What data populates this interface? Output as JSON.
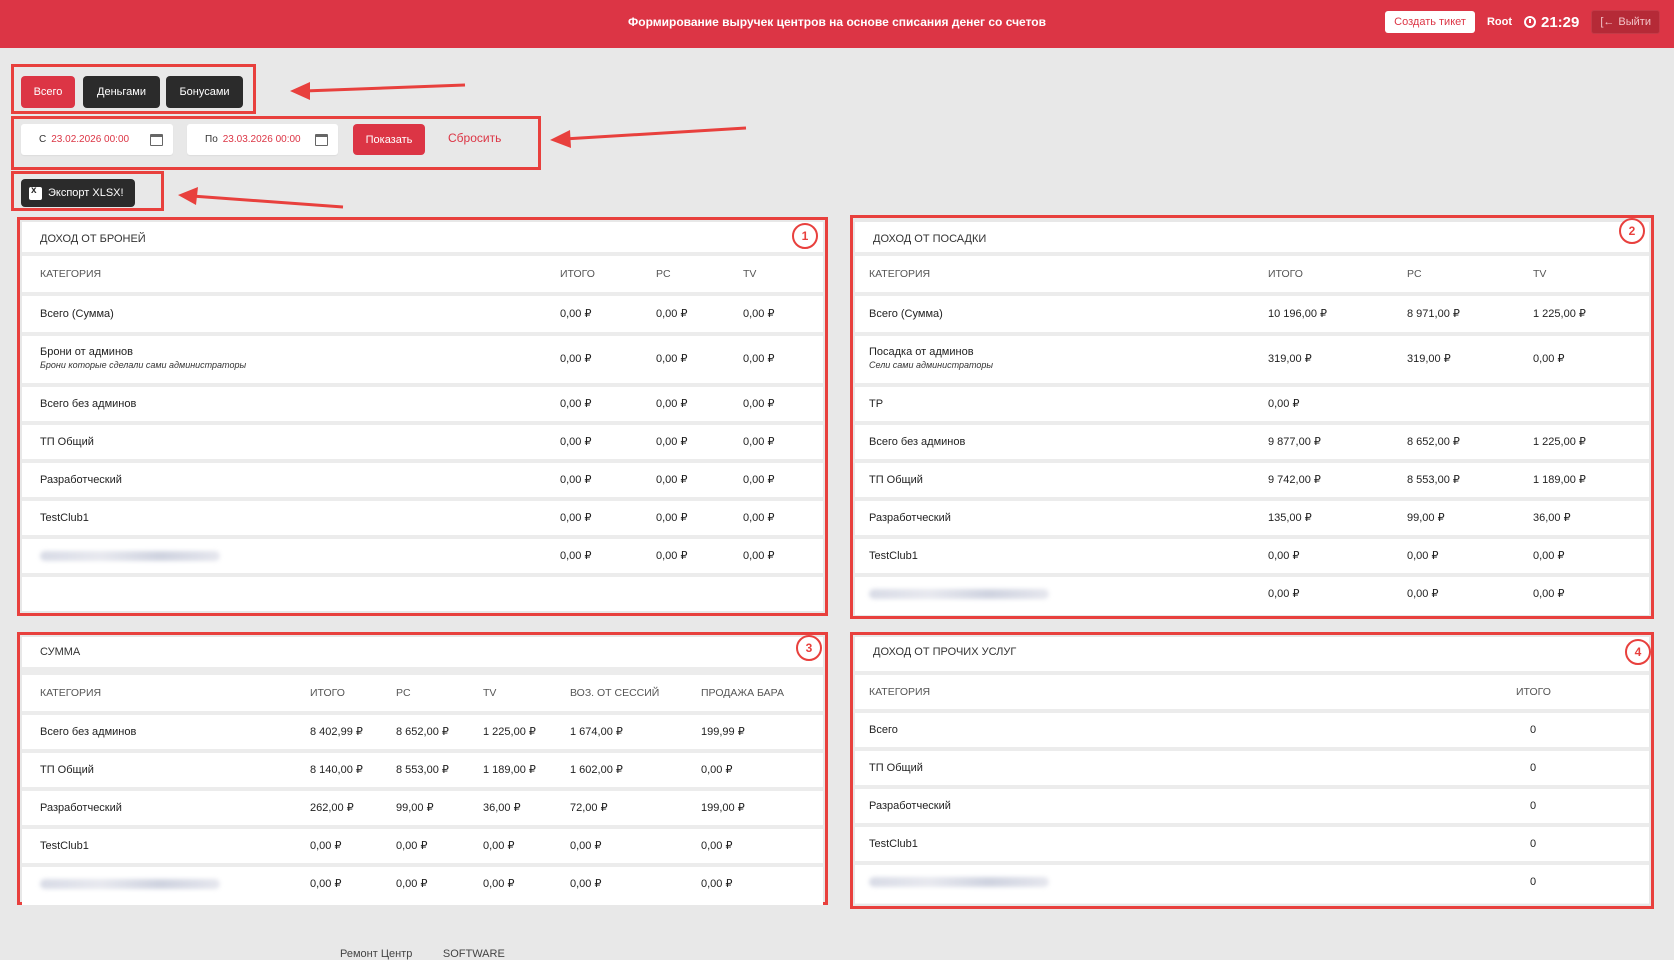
{
  "header": {
    "title": "Формирование выручек центров на основе списания денег со счетов",
    "create_ticket": "Создать тикет",
    "user": "Root",
    "time": "21:29",
    "logout": "Выйти"
  },
  "tabs": [
    "Всего",
    "Деньгами",
    "Бонусами"
  ],
  "filters": {
    "from_label": "С",
    "from_value": "23.02.2026 00:00",
    "to_label": "По",
    "to_value": "23.03.2026 00:00",
    "show": "Показать",
    "reset": "Сбросить"
  },
  "export_label": "Экспорт XLSX!",
  "panels": {
    "bookings": {
      "title": "Доход от броней",
      "badge": "1",
      "columns": [
        "Категория",
        "Итого",
        "PC",
        "TV"
      ],
      "rows": [
        {
          "category": "Всего (Сумма)",
          "values": [
            "0,00 ₽",
            "0,00 ₽",
            "0,00 ₽"
          ]
        },
        {
          "category": "Брони от админов",
          "sub": "Брони которые сделали сами администраторы",
          "values": [
            "0,00 ₽",
            "0,00 ₽",
            "0,00 ₽"
          ]
        },
        {
          "category": "Всего без админов",
          "values": [
            "0,00 ₽",
            "0,00 ₽",
            "0,00 ₽"
          ]
        },
        {
          "category": "ТП Общий",
          "values": [
            "0,00 ₽",
            "0,00 ₽",
            "0,00 ₽"
          ]
        },
        {
          "category": "Разработческий",
          "values": [
            "0,00 ₽",
            "0,00 ₽",
            "0,00 ₽"
          ]
        },
        {
          "category": "TestClub1",
          "values": [
            "0,00 ₽",
            "0,00 ₽",
            "0,00 ₽"
          ]
        },
        {
          "category": "",
          "values": [
            "0,00 ₽",
            "0,00 ₽",
            "0,00 ₽"
          ]
        }
      ]
    },
    "seating": {
      "title": "Доход от посадки",
      "badge": "2",
      "columns": [
        "Категория",
        "Итого",
        "PC",
        "TV"
      ],
      "rows": [
        {
          "category": "Всего (Сумма)",
          "values": [
            "10 196,00 ₽",
            "8 971,00 ₽",
            "1 225,00 ₽"
          ]
        },
        {
          "category": "Посадка от админов",
          "sub": "Сели сами администраторы",
          "values": [
            "319,00 ₽",
            "319,00 ₽",
            "0,00 ₽"
          ]
        },
        {
          "category": "TP",
          "values": [
            "0,00 ₽",
            "",
            ""
          ]
        },
        {
          "category": "Всего без админов",
          "values": [
            "9 877,00 ₽",
            "8 652,00 ₽",
            "1 225,00 ₽"
          ]
        },
        {
          "category": "ТП Общий",
          "values": [
            "9 742,00 ₽",
            "8 553,00 ₽",
            "1 189,00 ₽"
          ]
        },
        {
          "category": "Разработческий",
          "values": [
            "135,00 ₽",
            "99,00 ₽",
            "36,00 ₽"
          ]
        },
        {
          "category": "TestClub1",
          "values": [
            "0,00 ₽",
            "0,00 ₽",
            "0,00 ₽"
          ]
        },
        {
          "category": "",
          "values": [
            "0,00 ₽",
            "0,00 ₽",
            "0,00 ₽"
          ]
        }
      ]
    },
    "sum": {
      "title": "Сумма",
      "badge": "3",
      "columns": [
        "Категория",
        "Итого",
        "PC",
        "TV",
        "Воз. от сессий",
        "Продажа бара"
      ],
      "rows": [
        {
          "category": "Всего без админов",
          "values": [
            "8 402,99 ₽",
            "8 652,00 ₽",
            "1 225,00 ₽",
            "1 674,00 ₽",
            "199,99 ₽"
          ]
        },
        {
          "category": "ТП Общий",
          "values": [
            "8 140,00 ₽",
            "8 553,00 ₽",
            "1 189,00 ₽",
            "1 602,00 ₽",
            "0,00 ₽"
          ]
        },
        {
          "category": "Разработческий",
          "values": [
            "262,00 ₽",
            "99,00 ₽",
            "36,00 ₽",
            "72,00 ₽",
            "199,00 ₽"
          ]
        },
        {
          "category": "TestClub1",
          "values": [
            "0,00 ₽",
            "0,00 ₽",
            "0,00 ₽",
            "0,00 ₽",
            "0,00 ₽"
          ]
        },
        {
          "category": "",
          "values": [
            "0,00 ₽",
            "0,00 ₽",
            "0,00 ₽",
            "0,00 ₽",
            "0,00 ₽"
          ]
        }
      ]
    },
    "other": {
      "title": "Доход от прочих услуг",
      "badge": "4",
      "columns": [
        "Категория",
        "Итого"
      ],
      "rows": [
        {
          "category": "Всего",
          "values": [
            "0"
          ]
        },
        {
          "category": "ТП Общий",
          "values": [
            "0"
          ]
        },
        {
          "category": "Разработческий",
          "values": [
            "0"
          ]
        },
        {
          "category": "TestClub1",
          "values": [
            "0"
          ]
        },
        {
          "category": "",
          "values": [
            "0"
          ]
        }
      ]
    }
  },
  "footer_text": "Ремонт Центр          SOFTWARE",
  "colors": {
    "accent": "#dc3545",
    "annotation": "#e8403d",
    "dark_button": "#2b2b2b",
    "background": "#e8e8e8"
  }
}
